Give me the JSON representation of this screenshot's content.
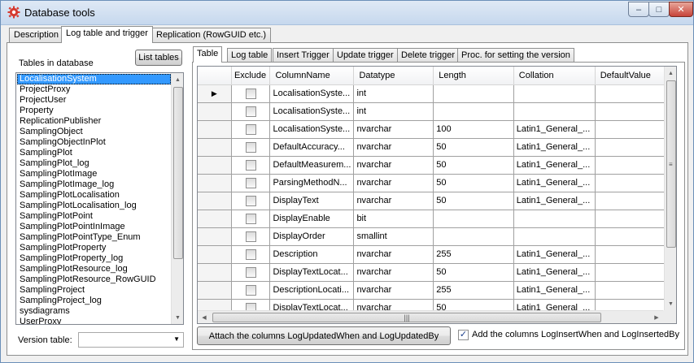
{
  "window": {
    "title": "Database tools",
    "controls": {
      "minimize": "–",
      "maximize": "□",
      "close": "✕"
    }
  },
  "outer_tabs": [
    {
      "label": "Description",
      "active": false
    },
    {
      "label": "Log table and trigger",
      "active": true
    },
    {
      "label": "Replication (RowGUID etc.)",
      "active": false
    }
  ],
  "left_panel": {
    "tables_label": "Tables in database",
    "list_tables_button": "List tables",
    "tables": [
      "LocalisationSystem",
      "ProjectProxy",
      "ProjectUser",
      "Property",
      "ReplicationPublisher",
      "SamplingObject",
      "SamplingObjectInPlot",
      "SamplingPlot",
      "SamplingPlot_log",
      "SamplingPlotImage",
      "SamplingPlotImage_log",
      "SamplingPlotLocalisation",
      "SamplingPlotLocalisation_log",
      "SamplingPlotPoint",
      "SamplingPlotPointInImage",
      "SamplingPlotPointType_Enum",
      "SamplingPlotProperty",
      "SamplingPlotProperty_log",
      "SamplingPlotResource_log",
      "SamplingPlotResource_RowGUID",
      "SamplingProject",
      "SamplingProject_log",
      "sysdiagrams",
      "UserProxy"
    ],
    "selected_table": "LocalisationSystem",
    "version_table_label": "Version table:",
    "version_table_value": ""
  },
  "inner_tabs": [
    {
      "label": "Table",
      "active": true
    },
    {
      "label": "Log table",
      "active": false
    },
    {
      "label": "Insert Trigger",
      "active": false
    },
    {
      "label": "Update trigger",
      "active": false
    },
    {
      "label": "Delete trigger",
      "active": false
    },
    {
      "label": "Proc. for setting the version",
      "active": false
    }
  ],
  "grid": {
    "columns": [
      "Exclude",
      "ColumnName",
      "Datatype",
      "Length",
      "Collation",
      "DefaultValue"
    ],
    "rows": [
      {
        "exclude": false,
        "column": "LocalisationSyste...",
        "datatype": "int",
        "length": "",
        "collation": "",
        "default": "",
        "current": true
      },
      {
        "exclude": false,
        "column": "LocalisationSyste...",
        "datatype": "int",
        "length": "",
        "collation": "",
        "default": ""
      },
      {
        "exclude": false,
        "column": "LocalisationSyste...",
        "datatype": "nvarchar",
        "length": "100",
        "collation": "Latin1_General_...",
        "default": ""
      },
      {
        "exclude": false,
        "column": "DefaultAccuracy...",
        "datatype": "nvarchar",
        "length": "50",
        "collation": "Latin1_General_...",
        "default": ""
      },
      {
        "exclude": false,
        "column": "DefaultMeasurem...",
        "datatype": "nvarchar",
        "length": "50",
        "collation": "Latin1_General_...",
        "default": ""
      },
      {
        "exclude": false,
        "column": "ParsingMethodN...",
        "datatype": "nvarchar",
        "length": "50",
        "collation": "Latin1_General_...",
        "default": ""
      },
      {
        "exclude": false,
        "column": "DisplayText",
        "datatype": "nvarchar",
        "length": "50",
        "collation": "Latin1_General_...",
        "default": ""
      },
      {
        "exclude": false,
        "column": "DisplayEnable",
        "datatype": "bit",
        "length": "",
        "collation": "",
        "default": ""
      },
      {
        "exclude": false,
        "column": "DisplayOrder",
        "datatype": "smallint",
        "length": "",
        "collation": "",
        "default": ""
      },
      {
        "exclude": false,
        "column": "Description",
        "datatype": "nvarchar",
        "length": "255",
        "collation": "Latin1_General_...",
        "default": ""
      },
      {
        "exclude": false,
        "column": "DisplayTextLocat...",
        "datatype": "nvarchar",
        "length": "50",
        "collation": "Latin1_General_...",
        "default": ""
      },
      {
        "exclude": false,
        "column": "DescriptionLocati...",
        "datatype": "nvarchar",
        "length": "255",
        "collation": "Latin1_General_...",
        "default": ""
      },
      {
        "exclude": false,
        "column": "DisplayTextLocat...",
        "datatype": "nvarchar",
        "length": "50",
        "collation": "Latin1_General_...",
        "default": ""
      }
    ]
  },
  "bottom": {
    "attach_button": "Attach the columns LogUpdatedWhen and LogUpdatedBy",
    "add_columns_label": "Add the columns LogInsertWhen and LogInsertedBy",
    "add_columns_checked": true
  },
  "colors": {
    "selection": "#3399ff",
    "title_gradient": "#c6d8ee",
    "close_button": "#c7443a"
  }
}
